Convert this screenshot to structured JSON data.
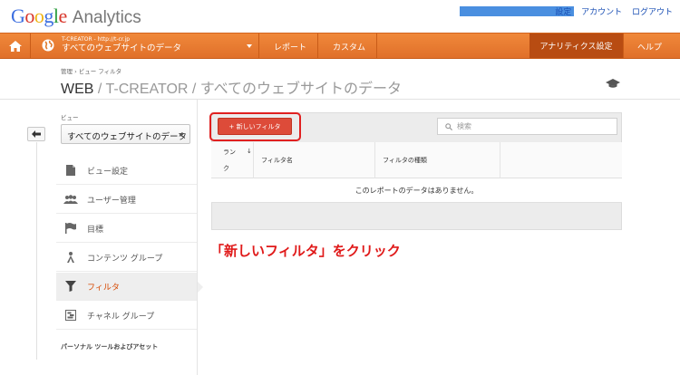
{
  "header": {
    "logo_google": [
      "G",
      "o",
      "o",
      "g",
      "l",
      "e"
    ],
    "logo_product": "Analytics",
    "links": [
      "設定",
      "アカウント",
      "ログアウト"
    ]
  },
  "nav": {
    "account_small": "T-CREATOR - http://t-cr.jp",
    "account_view": "すべてのウェブサイトのデータ",
    "tabs": [
      "レポート",
      "カスタム"
    ],
    "admin": "アナリティクス設定",
    "help": "ヘルプ",
    "accent_color": "#e67c2e"
  },
  "page": {
    "breadcrumb": "管理 › ビュー フィルタ",
    "title_main": "WEB",
    "title_rest": " / T-CREATOR / すべてのウェブサイトのデータ"
  },
  "sidebar": {
    "view_label": "ビュー",
    "view_selected": "すべてのウェブサイトのデータ",
    "items": [
      {
        "label": "ビュー設定",
        "icon": "document-icon"
      },
      {
        "label": "ユーザー管理",
        "icon": "users-icon"
      },
      {
        "label": "目標",
        "icon": "flag-icon"
      },
      {
        "label": "コンテンツ グループ",
        "icon": "person-icon"
      },
      {
        "label": "フィルタ",
        "icon": "filter-icon",
        "active": true
      },
      {
        "label": "チャネル グループ",
        "icon": "channel-icon"
      }
    ],
    "footer": "パーソナル ツールおよびアセット"
  },
  "main": {
    "new_filter_button": "+ 新しいフィルタ",
    "search_placeholder": "検索",
    "columns": {
      "rank_line1": "ラン",
      "rank_arrow": "↓",
      "rank_line2": "ク",
      "name": "フィルタ名",
      "type": "フィルタの種類"
    },
    "empty_message": "このレポートのデータはありません。"
  },
  "annotation": "「新しいフィルタ」をクリック"
}
